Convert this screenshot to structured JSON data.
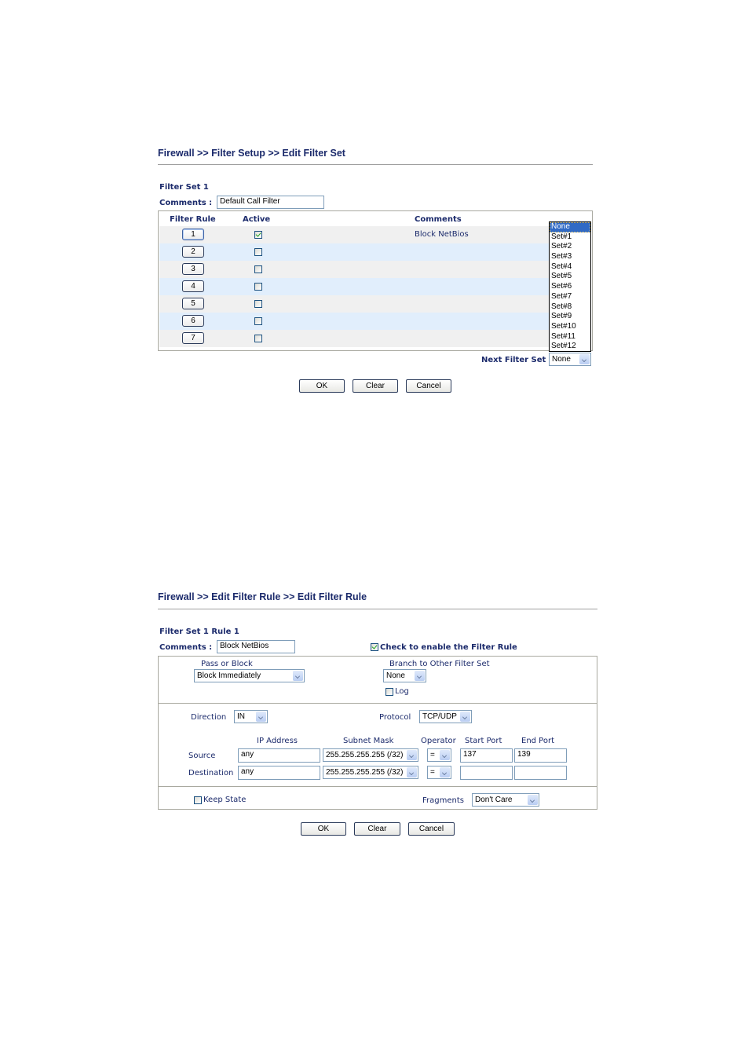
{
  "panel1": {
    "breadcrumb": "Firewall >> Filter Setup >> Edit Filter Set",
    "filter_set_title": "Filter Set 1",
    "comments_label": "Comments :",
    "comments_value": "Default Call Filter",
    "table": {
      "headers": [
        "Filter Rule",
        "Active",
        "Comments"
      ],
      "rows": [
        {
          "rule": "1",
          "active": true,
          "comment": "Block NetBios"
        },
        {
          "rule": "2",
          "active": false,
          "comment": ""
        },
        {
          "rule": "3",
          "active": false,
          "comment": ""
        },
        {
          "rule": "4",
          "active": false,
          "comment": ""
        },
        {
          "rule": "5",
          "active": false,
          "comment": ""
        },
        {
          "rule": "6",
          "active": false,
          "comment": ""
        },
        {
          "rule": "7",
          "active": false,
          "comment": ""
        }
      ]
    },
    "next_filter_set_label": "Next Filter Set",
    "next_filter_set_value": "None",
    "next_filter_set_options": [
      "None",
      "Set#1",
      "Set#2",
      "Set#3",
      "Set#4",
      "Set#5",
      "Set#6",
      "Set#7",
      "Set#8",
      "Set#9",
      "Set#10",
      "Set#11",
      "Set#12"
    ],
    "next_filter_set_highlighted": "None",
    "buttons": {
      "ok": "OK",
      "clear": "Clear",
      "cancel": "Cancel"
    }
  },
  "panel2": {
    "breadcrumb": "Firewall >> Edit Filter Rule >> Edit Filter Rule",
    "rule_title": "Filter Set 1 Rule 1",
    "comments_label": "Comments :",
    "comments_value": "Block NetBios",
    "enable_label": "Check to enable the Filter Rule",
    "enable_checked": true,
    "pass_or_block_label": "Pass or Block",
    "pass_or_block_value": "Block Immediately",
    "branch_label": "Branch to Other Filter Set",
    "branch_value": "None",
    "log_label": "Log",
    "log_checked": false,
    "direction_label": "Direction",
    "direction_value": "IN",
    "protocol_label": "Protocol",
    "protocol_value": "TCP/UDP",
    "columns": {
      "ip": "IP Address",
      "mask": "Subnet Mask",
      "operator": "Operator",
      "start": "Start Port",
      "end": "End Port"
    },
    "source": {
      "label": "Source",
      "ip": "any",
      "mask": "255.255.255.255 (/32)",
      "operator": "=",
      "start_port": "137",
      "end_port": "139"
    },
    "destination": {
      "label": "Destination",
      "ip": "any",
      "mask": "255.255.255.255 (/32)",
      "operator": "=",
      "start_port": "",
      "end_port": ""
    },
    "keep_state_label": "Keep State",
    "keep_state_checked": false,
    "fragments_label": "Fragments",
    "fragments_value": "Don't Care",
    "buttons": {
      "ok": "OK",
      "clear": "Clear",
      "cancel": "Cancel"
    }
  }
}
